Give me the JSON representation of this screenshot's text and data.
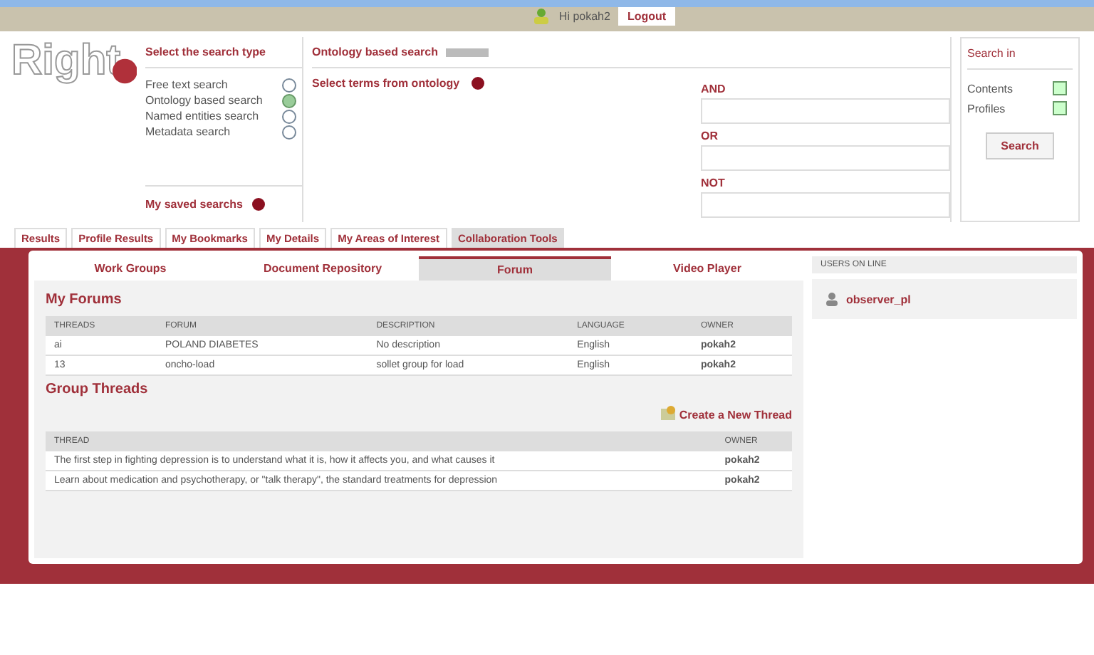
{
  "top_bar": {
    "user": "Hi pokah2",
    "logout": "Logout"
  },
  "logo": {
    "text": "Right"
  },
  "search_type": {
    "title": "Select the search type",
    "options": [
      {
        "label": "Free text search",
        "selected": false
      },
      {
        "label": "Ontology based search",
        "selected": true
      },
      {
        "label": "Named entities search",
        "selected": false
      },
      {
        "label": "Metadata search",
        "selected": false
      }
    ],
    "saved": "My saved searchs"
  },
  "ontology": {
    "title": "Ontology based search",
    "select_terms": "Select terms from ontology",
    "fields": [
      {
        "label": "AND"
      },
      {
        "label": "OR"
      },
      {
        "label": "NOT"
      }
    ]
  },
  "search_in": {
    "title": "Search in",
    "options": [
      {
        "label": "Contents",
        "checked": true
      },
      {
        "label": "Profiles",
        "checked": true
      }
    ],
    "button": "Search"
  },
  "tabs": [
    {
      "label": "Results",
      "selected": false
    },
    {
      "label": "Profile Results",
      "selected": false
    },
    {
      "label": "My Bookmarks",
      "selected": false
    },
    {
      "label": "My Details",
      "selected": false
    },
    {
      "label": "My Areas of Interest",
      "selected": false
    },
    {
      "label": "Collaboration Tools",
      "selected": true
    }
  ],
  "subtabs": [
    {
      "label": "Work Groups",
      "selected": false
    },
    {
      "label": "Document Repository",
      "selected": false
    },
    {
      "label": "Forum",
      "selected": true
    },
    {
      "label": "Video Player",
      "selected": false
    }
  ],
  "forums": {
    "title": "My Forums",
    "columns": [
      "THREADS",
      "FORUM",
      "DESCRIPTION",
      "LANGUAGE",
      "OWNER"
    ],
    "rows": [
      [
        "ai",
        "POLAND DIABETES",
        "No description",
        "English",
        "pokah2"
      ],
      [
        "13",
        "oncho-load",
        "sollet group for load",
        "English",
        "pokah2"
      ]
    ]
  },
  "threads": {
    "title": "Group Threads",
    "create": "Create a New Thread",
    "columns": [
      "THREAD",
      "OWNER"
    ],
    "rows": [
      [
        "The first step in fighting depression is to understand what it is, how it affects you, and what causes it",
        "pokah2"
      ],
      [
        "Learn about medication and psychotherapy, or \"talk therapy\", the standard treatments for depression",
        "pokah2"
      ]
    ]
  },
  "users_online": {
    "title": "USERS ON LINE",
    "users": [
      "observer_pl"
    ]
  }
}
